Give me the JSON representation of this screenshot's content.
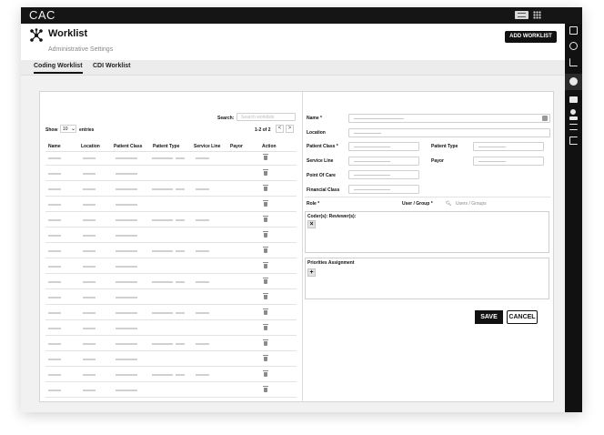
{
  "app": {
    "title": "CAC"
  },
  "header": {
    "title": "Worklist",
    "subtitle": "Administrative Settings",
    "add_button": "ADD WORKLIST"
  },
  "tabs": [
    {
      "label": "Coding Worklist",
      "active": true
    },
    {
      "label": "CDI Worklist",
      "active": false
    }
  ],
  "table": {
    "search_label": "Search:",
    "search_placeholder": "Search worklists",
    "show_label": "Show",
    "show_value": "10",
    "entries_label": "entries",
    "pagination_text": "1-2 of 2",
    "prev_glyph": "<",
    "next_glyph": ">",
    "columns": [
      "Name",
      "Location",
      "Patient Class",
      "Patient Type",
      "Service Line",
      "Payor",
      "Action"
    ]
  },
  "form": {
    "name_label": "Name",
    "location_label": "Location",
    "patient_class_label": "Patient Class",
    "patient_type_label": "Patient Type",
    "service_line_label": "Service Line",
    "payor_label": "Payor",
    "point_of_care_label": "Point Of Care",
    "financial_class_label": "Financial Class",
    "role_label": "Role",
    "user_group_label": "User / Group",
    "users_placeholder": "Users / Groups",
    "required_mark": "*",
    "coders_label": "Coder(s): Reviewer(s):",
    "remove_glyph": "×",
    "priorities_label": "Priorities Assignment",
    "add_glyph": "+",
    "save_button": "SAVE",
    "cancel_button": "CANCEL"
  },
  "icons": {
    "logo": "network-logo-icon",
    "sidebar": [
      "document-icon",
      "dashboard-icon",
      "bar-chart-icon",
      "gear-icon",
      "mail-icon",
      "user-icon",
      "transfer-icon",
      "logout-icon"
    ]
  },
  "colors": {
    "topbar": "#151515",
    "accent": "#111111",
    "panel_bg": "#f1f1f1"
  }
}
